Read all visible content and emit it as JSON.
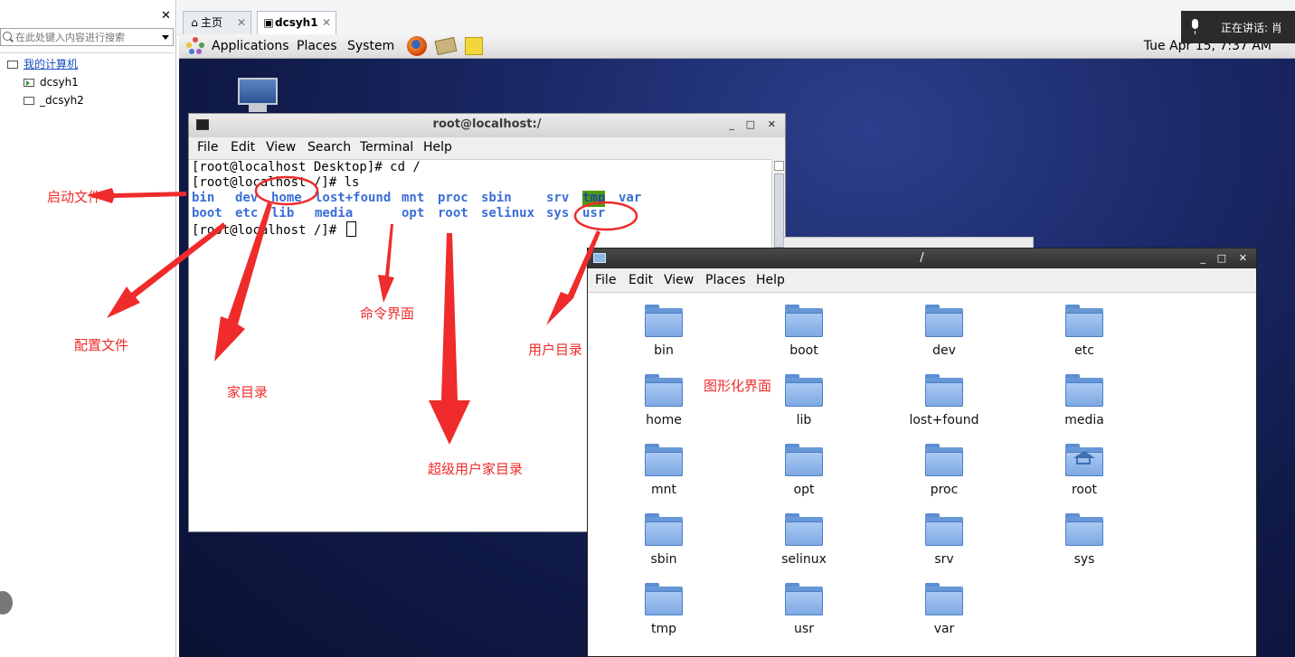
{
  "host": {
    "close_glyph": "✕",
    "search_placeholder": "在此处键入内容进行搜索",
    "tree_root": "我的计算机",
    "tree_items": [
      "dcsyh1",
      "_dcsyh2"
    ],
    "tabs": [
      {
        "label": "主页",
        "close": "✕"
      },
      {
        "label": "dcsyh1",
        "close": "✕"
      }
    ],
    "voice_text": "正在讲话: 肖",
    "icons": {
      "home": "home-icon",
      "vm": "vm-icon",
      "mic": "microphone-icon",
      "search": "search-icon"
    }
  },
  "guest_panel": {
    "menus": [
      "Applications",
      "Places",
      "System"
    ],
    "clock": "Tue Apr 15,  7:37 AM"
  },
  "terminal": {
    "title": "root@localhost:/",
    "menus": [
      "File",
      "Edit",
      "View",
      "Search",
      "Terminal",
      "Help"
    ],
    "lines": [
      "[root@localhost Desktop]# cd /",
      "[root@localhost /]# ls",
      "[root@localhost /]# "
    ],
    "ls_row1": [
      "bin",
      "dev",
      "home",
      "lost+found",
      "mnt",
      "proc",
      "sbin",
      "srv",
      "tmp",
      "var"
    ],
    "ls_row2": [
      "boot",
      "etc",
      "lib",
      "media",
      "opt",
      "root",
      "selinux",
      "sys",
      "usr"
    ],
    "dir_color": "#3a6ed6",
    "tmp_highlight": "#4e9a06",
    "controls": {
      "min": "_",
      "max": "□",
      "close": "✕"
    }
  },
  "file_manager": {
    "title": "/",
    "menus": [
      "File",
      "Edit",
      "View",
      "Places",
      "Help"
    ],
    "folders": [
      "bin",
      "boot",
      "dev",
      "etc",
      "home",
      "lib",
      "lost+found",
      "media",
      "mnt",
      "opt",
      "proc",
      "root",
      "sbin",
      "selinux",
      "srv",
      "sys",
      "tmp",
      "usr",
      "var"
    ],
    "controls": {
      "min": "_",
      "max": "□",
      "close": "✕"
    }
  },
  "annotations": {
    "startup_files": "启动文件",
    "config_files": "配置文件",
    "home_dirs": "家目录",
    "command_ui": "命令界面",
    "superuser_home": "超级用户家目录",
    "user_dir": "用户目录",
    "graphical_ui": "图形化界面",
    "color": "#ef2b2b"
  }
}
